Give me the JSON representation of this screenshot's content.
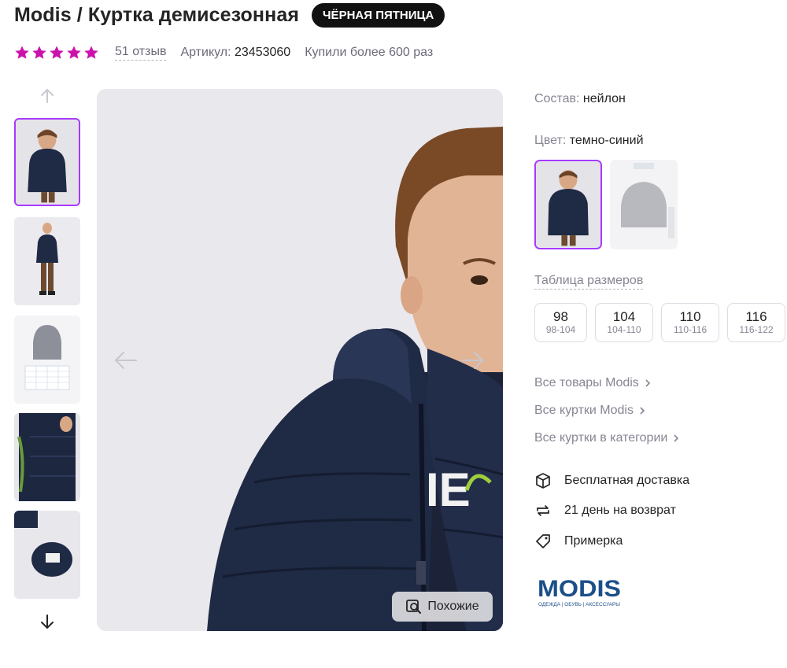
{
  "product": {
    "title": "Modis / Куртка демисезонная",
    "promo_badge": "ЧЁРНАЯ ПЯТНИЦА",
    "rating_stars": 5,
    "reviews": "51 отзыв",
    "article_label": "Артикул:",
    "article_number": "23453060",
    "purchases": "Купили более 600 раз"
  },
  "gallery": {
    "thumbnails": [
      {
        "name": "thumb-boy-jacket-front",
        "active": true
      },
      {
        "name": "thumb-boy-full-length",
        "active": false
      },
      {
        "name": "thumb-size-chart",
        "active": false
      },
      {
        "name": "thumb-jacket-lining",
        "active": false
      },
      {
        "name": "thumb-jacket-hood-label",
        "active": false
      }
    ],
    "similar_button": "Похожие"
  },
  "details": {
    "composition_label": "Состав:",
    "composition_value": "нейлон",
    "color_label": "Цвет:",
    "color_value": "темно-синий",
    "size_table_link": "Таблица размеров",
    "sizes": [
      {
        "size": "98",
        "range": "98-104"
      },
      {
        "size": "104",
        "range": "104-110"
      },
      {
        "size": "110",
        "range": "110-116"
      },
      {
        "size": "116",
        "range": "116-122"
      }
    ],
    "links": [
      "Все товары Modis",
      "Все куртки Modis",
      "Все куртки в категории"
    ],
    "benefits": [
      {
        "icon": "box-icon",
        "text": "Бесплатная доставка"
      },
      {
        "icon": "return-arrows-icon",
        "text": "21 день на возврат"
      },
      {
        "icon": "tag-icon",
        "text": "Примерка"
      }
    ],
    "brand_logo_text": "MODIS",
    "brand_logo_tagline": "ОДЕЖДА | ОБУВЬ | АКСЕССУАРЫ"
  },
  "colors": {
    "accent": "#a73afd",
    "star": "#cb11ab",
    "muted_text": "#868695",
    "jacket_navy": "#1f2a44",
    "brand_blue": "#1b4f8a"
  }
}
